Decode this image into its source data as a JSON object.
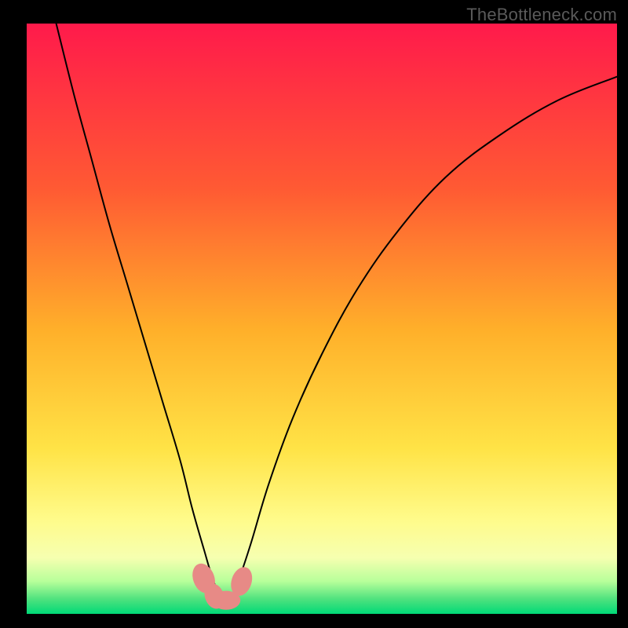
{
  "watermark": {
    "text": "TheBottleneck.com"
  },
  "chart_data": {
    "type": "line",
    "title": "",
    "xlabel": "",
    "ylabel": "",
    "xlim": [
      0,
      100
    ],
    "ylim": [
      0,
      100
    ],
    "grid": false,
    "legend": false,
    "background": {
      "gradient_stops": [
        {
          "offset": 0.0,
          "color": "#ff1a4b"
        },
        {
          "offset": 0.28,
          "color": "#ff5a33"
        },
        {
          "offset": 0.52,
          "color": "#ffb02a"
        },
        {
          "offset": 0.72,
          "color": "#ffe346"
        },
        {
          "offset": 0.84,
          "color": "#fffb8a"
        },
        {
          "offset": 0.905,
          "color": "#f6ffb0"
        },
        {
          "offset": 0.945,
          "color": "#b7ff9a"
        },
        {
          "offset": 0.975,
          "color": "#4fe27e"
        },
        {
          "offset": 1.0,
          "color": "#00d977"
        }
      ]
    },
    "series": [
      {
        "name": "bottleneck-curve",
        "color": "#000000",
        "stroke_width": 2,
        "x": [
          5,
          8,
          11,
          14,
          17,
          20,
          23,
          26,
          28,
          30,
          31.5,
          33,
          34.5,
          36,
          38,
          41,
          45,
          50,
          56,
          63,
          71,
          80,
          90,
          100
        ],
        "y": [
          100,
          88,
          77,
          66,
          56,
          46,
          36,
          26,
          18,
          11,
          6,
          2.5,
          2.5,
          6,
          12,
          22,
          33,
          44,
          55,
          65,
          74,
          81,
          87,
          91
        ]
      }
    ],
    "markers": [
      {
        "shape": "rounded-blob",
        "cx": 30.0,
        "cy": 6.0,
        "rx": 1.8,
        "ry": 2.6,
        "angle": -20,
        "color": "#e78a86"
      },
      {
        "shape": "rounded-blob",
        "cx": 31.8,
        "cy": 3.0,
        "rx": 1.6,
        "ry": 2.2,
        "angle": -20,
        "color": "#e78a86"
      },
      {
        "shape": "rounded-blob",
        "cx": 33.8,
        "cy": 2.3,
        "rx": 2.4,
        "ry": 1.6,
        "angle": 0,
        "color": "#e78a86"
      },
      {
        "shape": "rounded-blob",
        "cx": 36.4,
        "cy": 5.5,
        "rx": 1.7,
        "ry": 2.5,
        "angle": 18,
        "color": "#e78a86"
      }
    ]
  }
}
